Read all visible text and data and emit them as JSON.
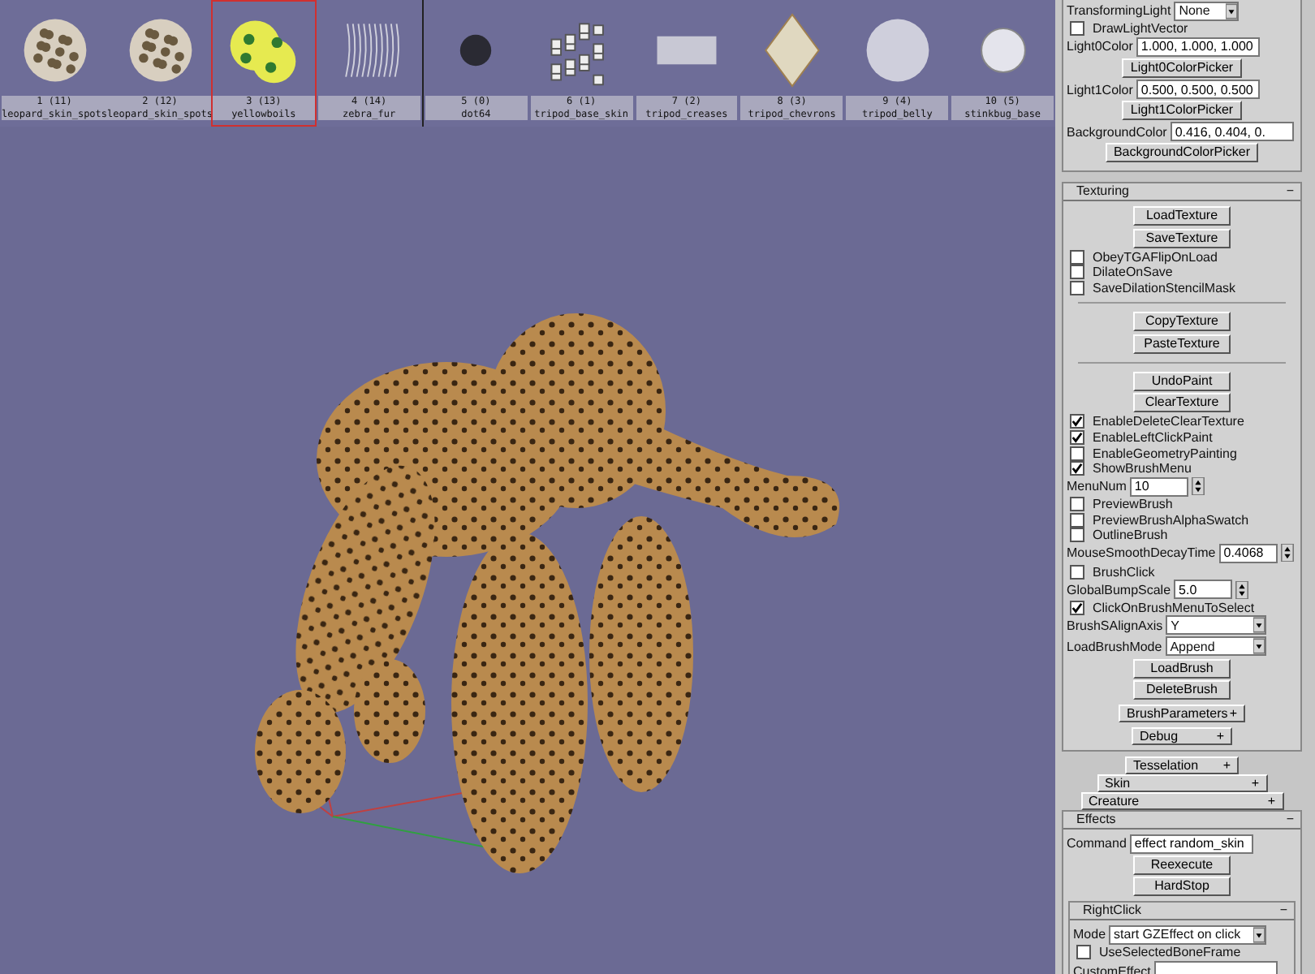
{
  "brushes": [
    {
      "label": "1   (11)",
      "name": "leopard_skin_spots",
      "selected": false,
      "kind": "spots"
    },
    {
      "label": "2   (12)",
      "name": "leopard_skin_spots",
      "selected": false,
      "kind": "spots"
    },
    {
      "label": "3   (13)",
      "name": "yellowboils",
      "selected": true,
      "kind": "boils"
    },
    {
      "label": "4   (14)",
      "name": "zebra_fur",
      "selected": false,
      "kind": "fur"
    },
    {
      "label": "5   (0)",
      "name": "dot64",
      "selected": false,
      "kind": "dot"
    },
    {
      "label": "6   (1)",
      "name": "tripod_base_skin",
      "selected": false,
      "kind": "cubes"
    },
    {
      "label": "7   (2)",
      "name": "tripod_creases",
      "selected": false,
      "kind": "creases"
    },
    {
      "label": "8   (3)",
      "name": "tripod_chevrons",
      "selected": false,
      "kind": "chevron"
    },
    {
      "label": "9   (4)",
      "name": "tripod_belly",
      "selected": false,
      "kind": "belly"
    },
    {
      "label": "10   (5)",
      "name": "stinkbug_base",
      "selected": false,
      "kind": "disc"
    }
  ],
  "lighting": {
    "items": [
      {
        "kind": "dropdown",
        "label": "TransformingLight",
        "value": "None"
      },
      {
        "kind": "checkbox",
        "label": "DrawLightVector",
        "checked": false
      },
      {
        "kind": "field",
        "label": "Light0Color",
        "value": "1.000, 1.000, 1.000"
      },
      {
        "kind": "button",
        "label": "Light0ColorPicker"
      },
      {
        "kind": "field",
        "label": "Light1Color",
        "value": "0.500, 0.500, 0.500"
      },
      {
        "kind": "button",
        "label": "Light1ColorPicker"
      },
      {
        "kind": "field",
        "label": "BackgroundColor",
        "value": "0.416, 0.404, 0."
      },
      {
        "kind": "button",
        "label": "BackgroundColorPicker"
      }
    ]
  },
  "texturing": {
    "title": "Texturing",
    "toggle": "−",
    "items": [
      {
        "kind": "button",
        "label": "LoadTexture"
      },
      {
        "kind": "button",
        "label": "SaveTexture"
      },
      {
        "kind": "checkbox",
        "label": "ObeyTGAFlipOnLoad",
        "checked": false
      },
      {
        "kind": "checkbox",
        "label": "DilateOnSave",
        "checked": false
      },
      {
        "kind": "checkbox",
        "label": "SaveDilationStencilMask",
        "checked": false
      },
      {
        "kind": "divider"
      },
      {
        "kind": "button",
        "label": "CopyTexture"
      },
      {
        "kind": "button",
        "label": "PasteTexture"
      },
      {
        "kind": "divider"
      },
      {
        "kind": "button",
        "label": "UndoPaint"
      },
      {
        "kind": "button",
        "label": "ClearTexture"
      },
      {
        "kind": "checkbox",
        "label": "EnableDeleteClearTexture",
        "checked": true
      },
      {
        "kind": "checkbox",
        "label": "EnableLeftClickPaint",
        "checked": true
      },
      {
        "kind": "checkbox",
        "label": "EnableGeometryPainting",
        "checked": false
      },
      {
        "kind": "checkbox",
        "label": "ShowBrushMenu",
        "checked": true
      },
      {
        "kind": "spin",
        "label": "MenuNum",
        "value": "10"
      },
      {
        "kind": "checkbox",
        "label": "PreviewBrush",
        "checked": false
      },
      {
        "kind": "checkbox",
        "label": "PreviewBrushAlphaSwatch",
        "checked": false
      },
      {
        "kind": "checkbox",
        "label": "OutlineBrush",
        "checked": false
      },
      {
        "kind": "spin",
        "label": "MouseSmoothDecayTime",
        "value": "0.4068"
      },
      {
        "kind": "checkbox",
        "label": "BrushClick",
        "checked": false
      },
      {
        "kind": "spin",
        "label": "GlobalBumpScale",
        "value": "5.0"
      },
      {
        "kind": "checkbox",
        "label": "ClickOnBrushMenuToSelect",
        "checked": true
      },
      {
        "kind": "dropdown",
        "label": "BrushSAlignAxis",
        "value": "Y"
      },
      {
        "kind": "dropdown",
        "label": "LoadBrushMode",
        "value": "Append"
      },
      {
        "kind": "button",
        "label": "LoadBrush"
      },
      {
        "kind": "button",
        "label": "DeleteBrush"
      },
      {
        "kind": "group",
        "label": "BrushParameters",
        "toggle": "+"
      },
      {
        "kind": "group",
        "label": "Debug",
        "toggle": "+"
      }
    ]
  },
  "groups": [
    {
      "label": "Tesselation",
      "toggle": "+"
    },
    {
      "label": "Skin",
      "toggle": "+"
    },
    {
      "label": "Creature",
      "toggle": "+"
    }
  ],
  "effects": {
    "title": "Effects",
    "toggle": "−",
    "items": [
      {
        "kind": "field",
        "label": "Command",
        "value": "effect random_skin"
      },
      {
        "kind": "button",
        "label": "Reexecute"
      },
      {
        "kind": "button",
        "label": "HardStop"
      }
    ],
    "right_click": {
      "title": "RightClick",
      "toggle": "−",
      "items": [
        {
          "kind": "dropdown",
          "label": "Mode",
          "value": "start GZEffect on click"
        },
        {
          "kind": "checkbox",
          "label": "UseSelectedBoneFrame",
          "checked": false
        },
        {
          "kind": "field",
          "label": "CustomEffect",
          "value": ""
        }
      ]
    }
  }
}
